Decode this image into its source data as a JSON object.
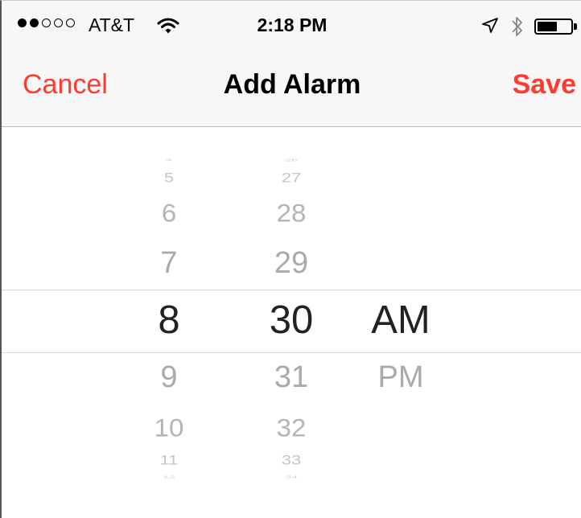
{
  "status_bar": {
    "signal_dots": [
      "filled",
      "filled",
      "empty",
      "empty",
      "empty"
    ],
    "carrier": "AT&T",
    "time": "2:18 PM",
    "icons": [
      "wifi-icon",
      "location-arrow-icon",
      "bluetooth-icon",
      "battery-icon"
    ],
    "battery_level": 0.6
  },
  "nav": {
    "cancel_label": "Cancel",
    "title": "Add Alarm",
    "save_label": "Save"
  },
  "picker": {
    "hour": {
      "selected": "8",
      "items": [
        "4",
        "5",
        "6",
        "7",
        "8",
        "9",
        "10",
        "11",
        "12"
      ]
    },
    "minute": {
      "selected": "30",
      "items": [
        "26",
        "27",
        "28",
        "29",
        "30",
        "31",
        "32",
        "33",
        "34"
      ]
    },
    "period": {
      "selected": "AM",
      "items": [
        "AM",
        "PM"
      ]
    }
  },
  "colors": {
    "accent": "#ff3b30",
    "bar_background": "#f7f7f7",
    "selected_text": "#222222",
    "dim_text": "#aaaaaa"
  }
}
